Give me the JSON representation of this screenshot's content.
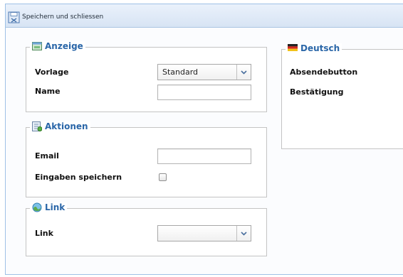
{
  "toolbar": {
    "save_close_label": "Speichern und schliessen"
  },
  "anzeige": {
    "legend": "Anzeige",
    "vorlage_label": "Vorlage",
    "vorlage_value": "Standard",
    "name_label": "Name",
    "name_value": ""
  },
  "aktionen": {
    "legend": "Aktionen",
    "email_label": "Email",
    "email_value": "",
    "save_inputs_label": "Eingaben speichern",
    "save_inputs_checked": false
  },
  "link": {
    "legend": "Link",
    "link_label": "Link",
    "link_value": ""
  },
  "deutsch": {
    "legend": "Deutsch",
    "submit_button_label": "Absendebutton",
    "confirmation_label": "Bestätigung"
  },
  "colors": {
    "legend_text": "#2a66a8",
    "toolbar_border": "#a9c4e2"
  },
  "icons": {
    "save_close": "save-close-icon",
    "anzeige": "display-icon",
    "aktionen": "actions-icon",
    "link": "globe-link-icon",
    "deutsch": "german-flag-icon",
    "dropdown": "chevron-down-icon"
  }
}
